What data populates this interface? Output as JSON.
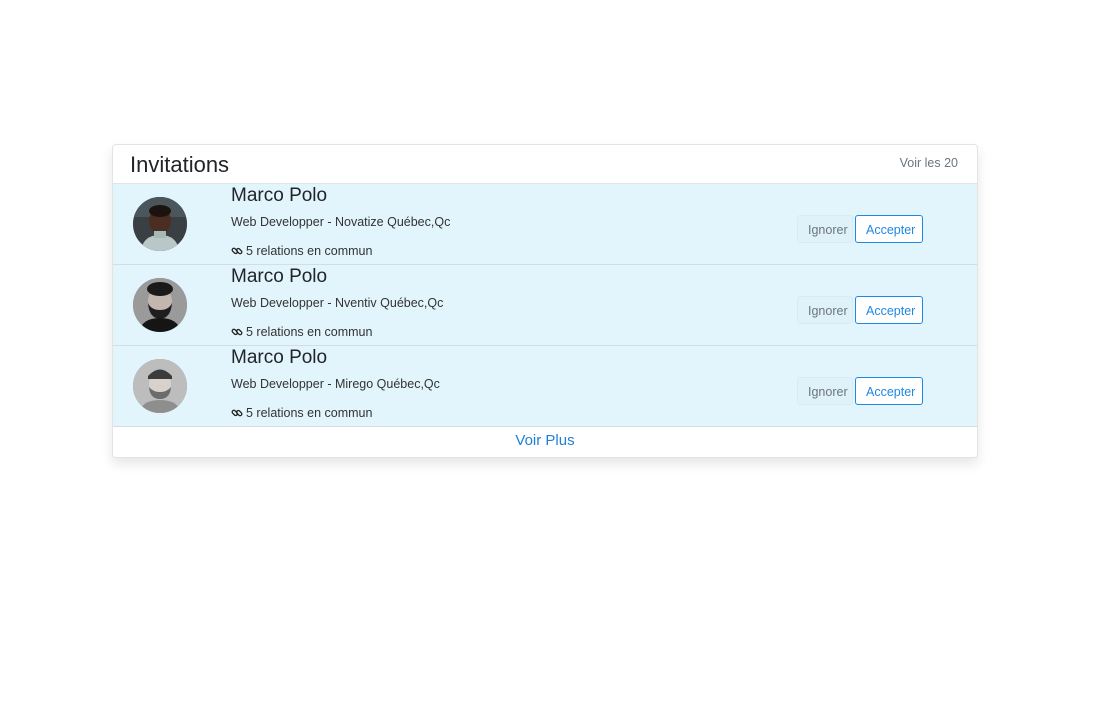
{
  "card": {
    "title": "Invitations",
    "see_all_label": "Voir les 20",
    "see_more_label": "Voir Plus"
  },
  "invitations": [
    {
      "name": "Marco Polo",
      "job": "Web Developper - Novatize Québec,Qc",
      "mutual": "5 relations en commun",
      "ignore_label": "Ignorer",
      "accept_label": "Accepter"
    },
    {
      "name": "Marco Polo",
      "job": "Web Developper - Nventiv Québec,Qc",
      "mutual": "5 relations en commun",
      "ignore_label": "Ignorer",
      "accept_label": "Accepter"
    },
    {
      "name": "Marco Polo",
      "job": "Web Developper - Mirego Québec,Qc",
      "mutual": "5 relations en commun",
      "ignore_label": "Ignorer",
      "accept_label": "Accepter"
    }
  ],
  "icons": {
    "mutual": "link-icon",
    "avatar": "profile-photo"
  },
  "colors": {
    "row_background": "#e3f5fc",
    "accent": "#1e88e5",
    "muted": "#6c757d"
  }
}
